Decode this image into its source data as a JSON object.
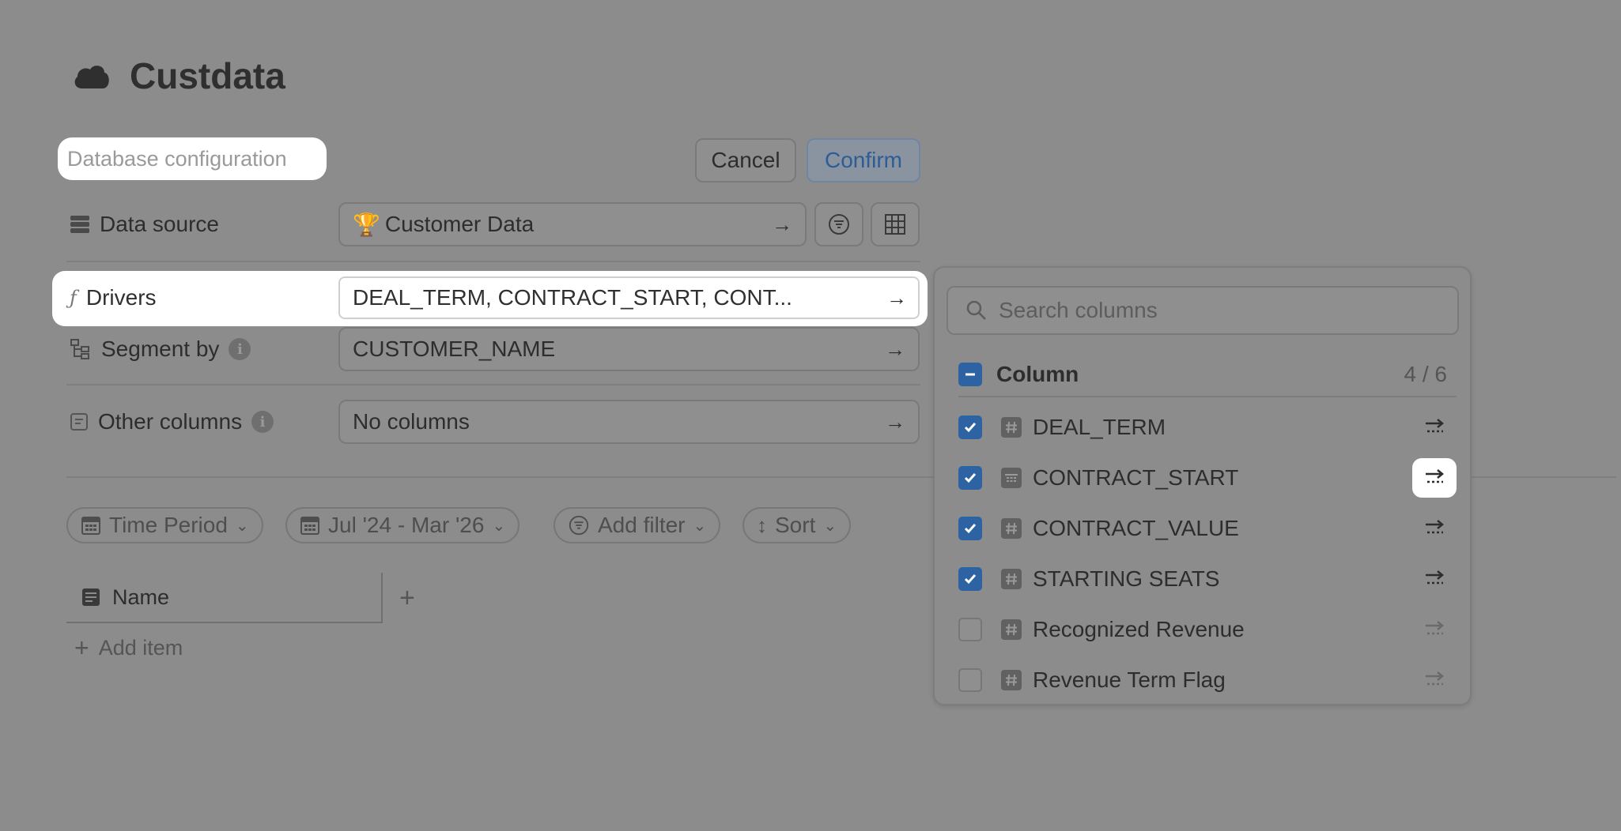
{
  "page": {
    "title": "Custdata",
    "title_icon": "cloud-icon"
  },
  "config_label": "Database configuration",
  "actions": {
    "cancel": "Cancel",
    "confirm": "Confirm"
  },
  "rows": {
    "data_source": {
      "label": "Data source",
      "icon": "database-icon",
      "value": "Customer Data",
      "emoji": "🏆"
    },
    "drivers": {
      "label": "Drivers",
      "icon": "function-icon",
      "value": "DEAL_TERM, CONTRACT_START, CONT..."
    },
    "segment_by": {
      "label": "Segment by",
      "icon": "hierarchy-icon",
      "value": "CUSTOMER_NAME",
      "info": "i"
    },
    "other_columns": {
      "label": "Other columns",
      "icon": "note-icon",
      "value": "No columns",
      "info": "i"
    }
  },
  "filters": {
    "time_period": "Time Period",
    "date_range": "Jul '24 - Mar '26",
    "add_filter": "Add filter",
    "sort": "Sort"
  },
  "table": {
    "name_header": "Name",
    "add_column": "+",
    "add_item": "Add item"
  },
  "dropdown": {
    "search_placeholder": "Search columns",
    "header": {
      "label": "Column",
      "count": "4 / 6"
    },
    "columns": [
      {
        "name": "DEAL_TERM",
        "type": "number",
        "checked": true
      },
      {
        "name": "CONTRACT_START",
        "type": "date",
        "checked": true
      },
      {
        "name": "CONTRACT_VALUE",
        "type": "number",
        "checked": true
      },
      {
        "name": "STARTING SEATS",
        "type": "number",
        "checked": true
      },
      {
        "name": "Recognized Revenue",
        "type": "number",
        "checked": false
      },
      {
        "name": "Revenue Term Flag",
        "type": "number",
        "checked": false
      }
    ]
  },
  "colors": {
    "accent": "#2e63a3",
    "overlay": "#8c8c8c",
    "highlight": "#ffffff"
  }
}
